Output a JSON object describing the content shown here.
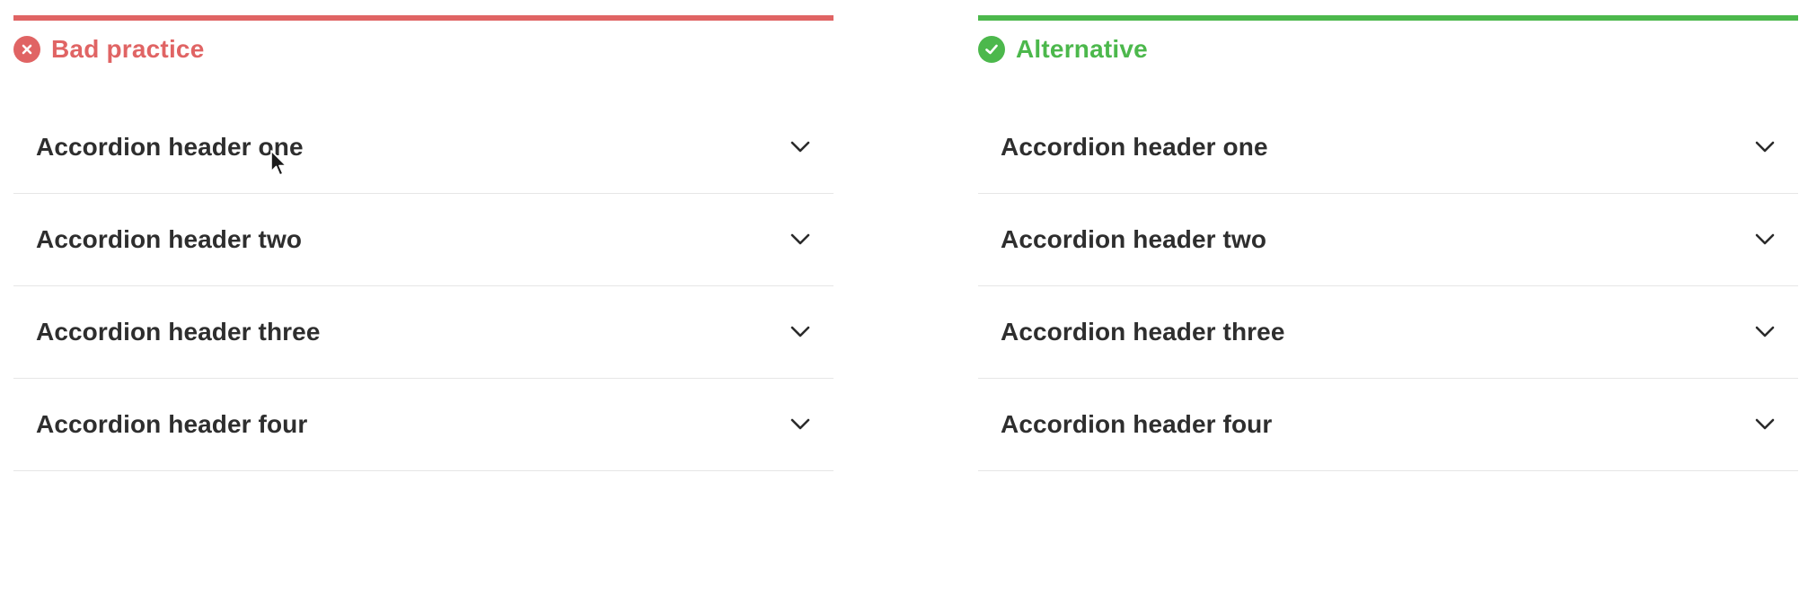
{
  "panels": {
    "bad": {
      "title": "Bad practice",
      "accent": "#e06464",
      "status_icon": "x-circle-icon",
      "items": [
        {
          "label": "Accordion header one"
        },
        {
          "label": "Accordion header two"
        },
        {
          "label": "Accordion header three"
        },
        {
          "label": "Accordion header four"
        }
      ]
    },
    "good": {
      "title": "Alternative",
      "accent": "#4cb84c",
      "status_icon": "check-circle-icon",
      "items": [
        {
          "label": "Accordion header one"
        },
        {
          "label": "Accordion header two"
        },
        {
          "label": "Accordion header three"
        },
        {
          "label": "Accordion header four"
        }
      ]
    }
  },
  "item_icon": "chevron-down-icon",
  "pointer": "mouse-pointer-icon"
}
